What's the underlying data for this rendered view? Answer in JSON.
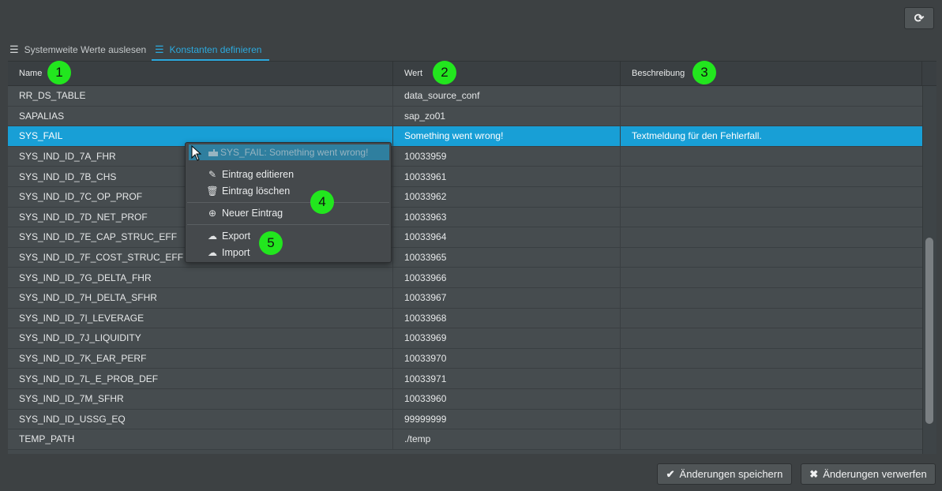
{
  "toolbar": {
    "refresh_icon": "refresh-icon",
    "refresh_glyph": "⟳"
  },
  "tabs": [
    {
      "label": "Systemweite Werte auslesen",
      "icon": "list-icon",
      "glyph": "☰",
      "active": false
    },
    {
      "label": "Konstanten definieren",
      "icon": "list-icon",
      "glyph": "☰",
      "active": true
    }
  ],
  "table": {
    "columns": [
      "Name",
      "Wert",
      "Beschreibung"
    ],
    "rows": [
      {
        "name": "RR_DS_TABLE",
        "value": "data_source_conf",
        "description": ""
      },
      {
        "name": "SAPALIAS",
        "value": "sap_zo01",
        "description": ""
      },
      {
        "name": "SYS_FAIL",
        "value": "Something went wrong!",
        "description": "Textmeldung für den Fehlerfall.",
        "selected": true
      },
      {
        "name": "SYS_IND_ID_7A_FHR",
        "value": "10033959",
        "description": ""
      },
      {
        "name": "SYS_IND_ID_7B_CHS",
        "value": "10033961",
        "description": ""
      },
      {
        "name": "SYS_IND_ID_7C_OP_PROF",
        "value": "10033962",
        "description": ""
      },
      {
        "name": "SYS_IND_ID_7D_NET_PROF",
        "value": "10033963",
        "description": ""
      },
      {
        "name": "SYS_IND_ID_7E_CAP_STRUC_EFF",
        "value": "10033964",
        "description": ""
      },
      {
        "name": "SYS_IND_ID_7F_COST_STRUC_EFF",
        "value": "10033965",
        "description": ""
      },
      {
        "name": "SYS_IND_ID_7G_DELTA_FHR",
        "value": "10033966",
        "description": ""
      },
      {
        "name": "SYS_IND_ID_7H_DELTA_SFHR",
        "value": "10033967",
        "description": ""
      },
      {
        "name": "SYS_IND_ID_7I_LEVERAGE",
        "value": "10033968",
        "description": ""
      },
      {
        "name": "SYS_IND_ID_7J_LIQUIDITY",
        "value": "10033969",
        "description": ""
      },
      {
        "name": "SYS_IND_ID_7K_EAR_PERF",
        "value": "10033970",
        "description": ""
      },
      {
        "name": "SYS_IND_ID_7L_E_PROB_DEF",
        "value": "10033971",
        "description": ""
      },
      {
        "name": "SYS_IND_ID_7M_SFHR",
        "value": "10033960",
        "description": ""
      },
      {
        "name": "SYS_IND_ID_USSG_EQ",
        "value": "99999999",
        "description": ""
      },
      {
        "name": "TEMP_PATH",
        "value": "./temp",
        "description": ""
      }
    ]
  },
  "context_menu": {
    "header": "SYS_FAIL: Something went wrong!",
    "header_icon": "hand-pointer-icon",
    "items": [
      {
        "label": "Eintrag editieren",
        "icon": "pencil-icon",
        "glyph": "✎"
      },
      {
        "label": "Eintrag löschen",
        "icon": "trash-icon",
        "glyph": "🗑"
      },
      {
        "label": "Neuer Eintrag",
        "icon": "plus-circle-icon",
        "glyph": "⊕"
      },
      {
        "label": "Export",
        "icon": "cloud-download-icon",
        "glyph": "☁"
      },
      {
        "label": "Import",
        "icon": "cloud-upload-icon",
        "glyph": "☁"
      }
    ]
  },
  "badges": [
    "1",
    "2",
    "3",
    "4",
    "5"
  ],
  "footer": {
    "save_label": "Änderungen speichern",
    "save_icon": "check-icon",
    "discard_label": "Änderungen verwerfen",
    "discard_icon": "times-icon"
  },
  "colors": {
    "accent": "#189fd6",
    "background": "#3d4143",
    "badge": "#22e61e"
  }
}
